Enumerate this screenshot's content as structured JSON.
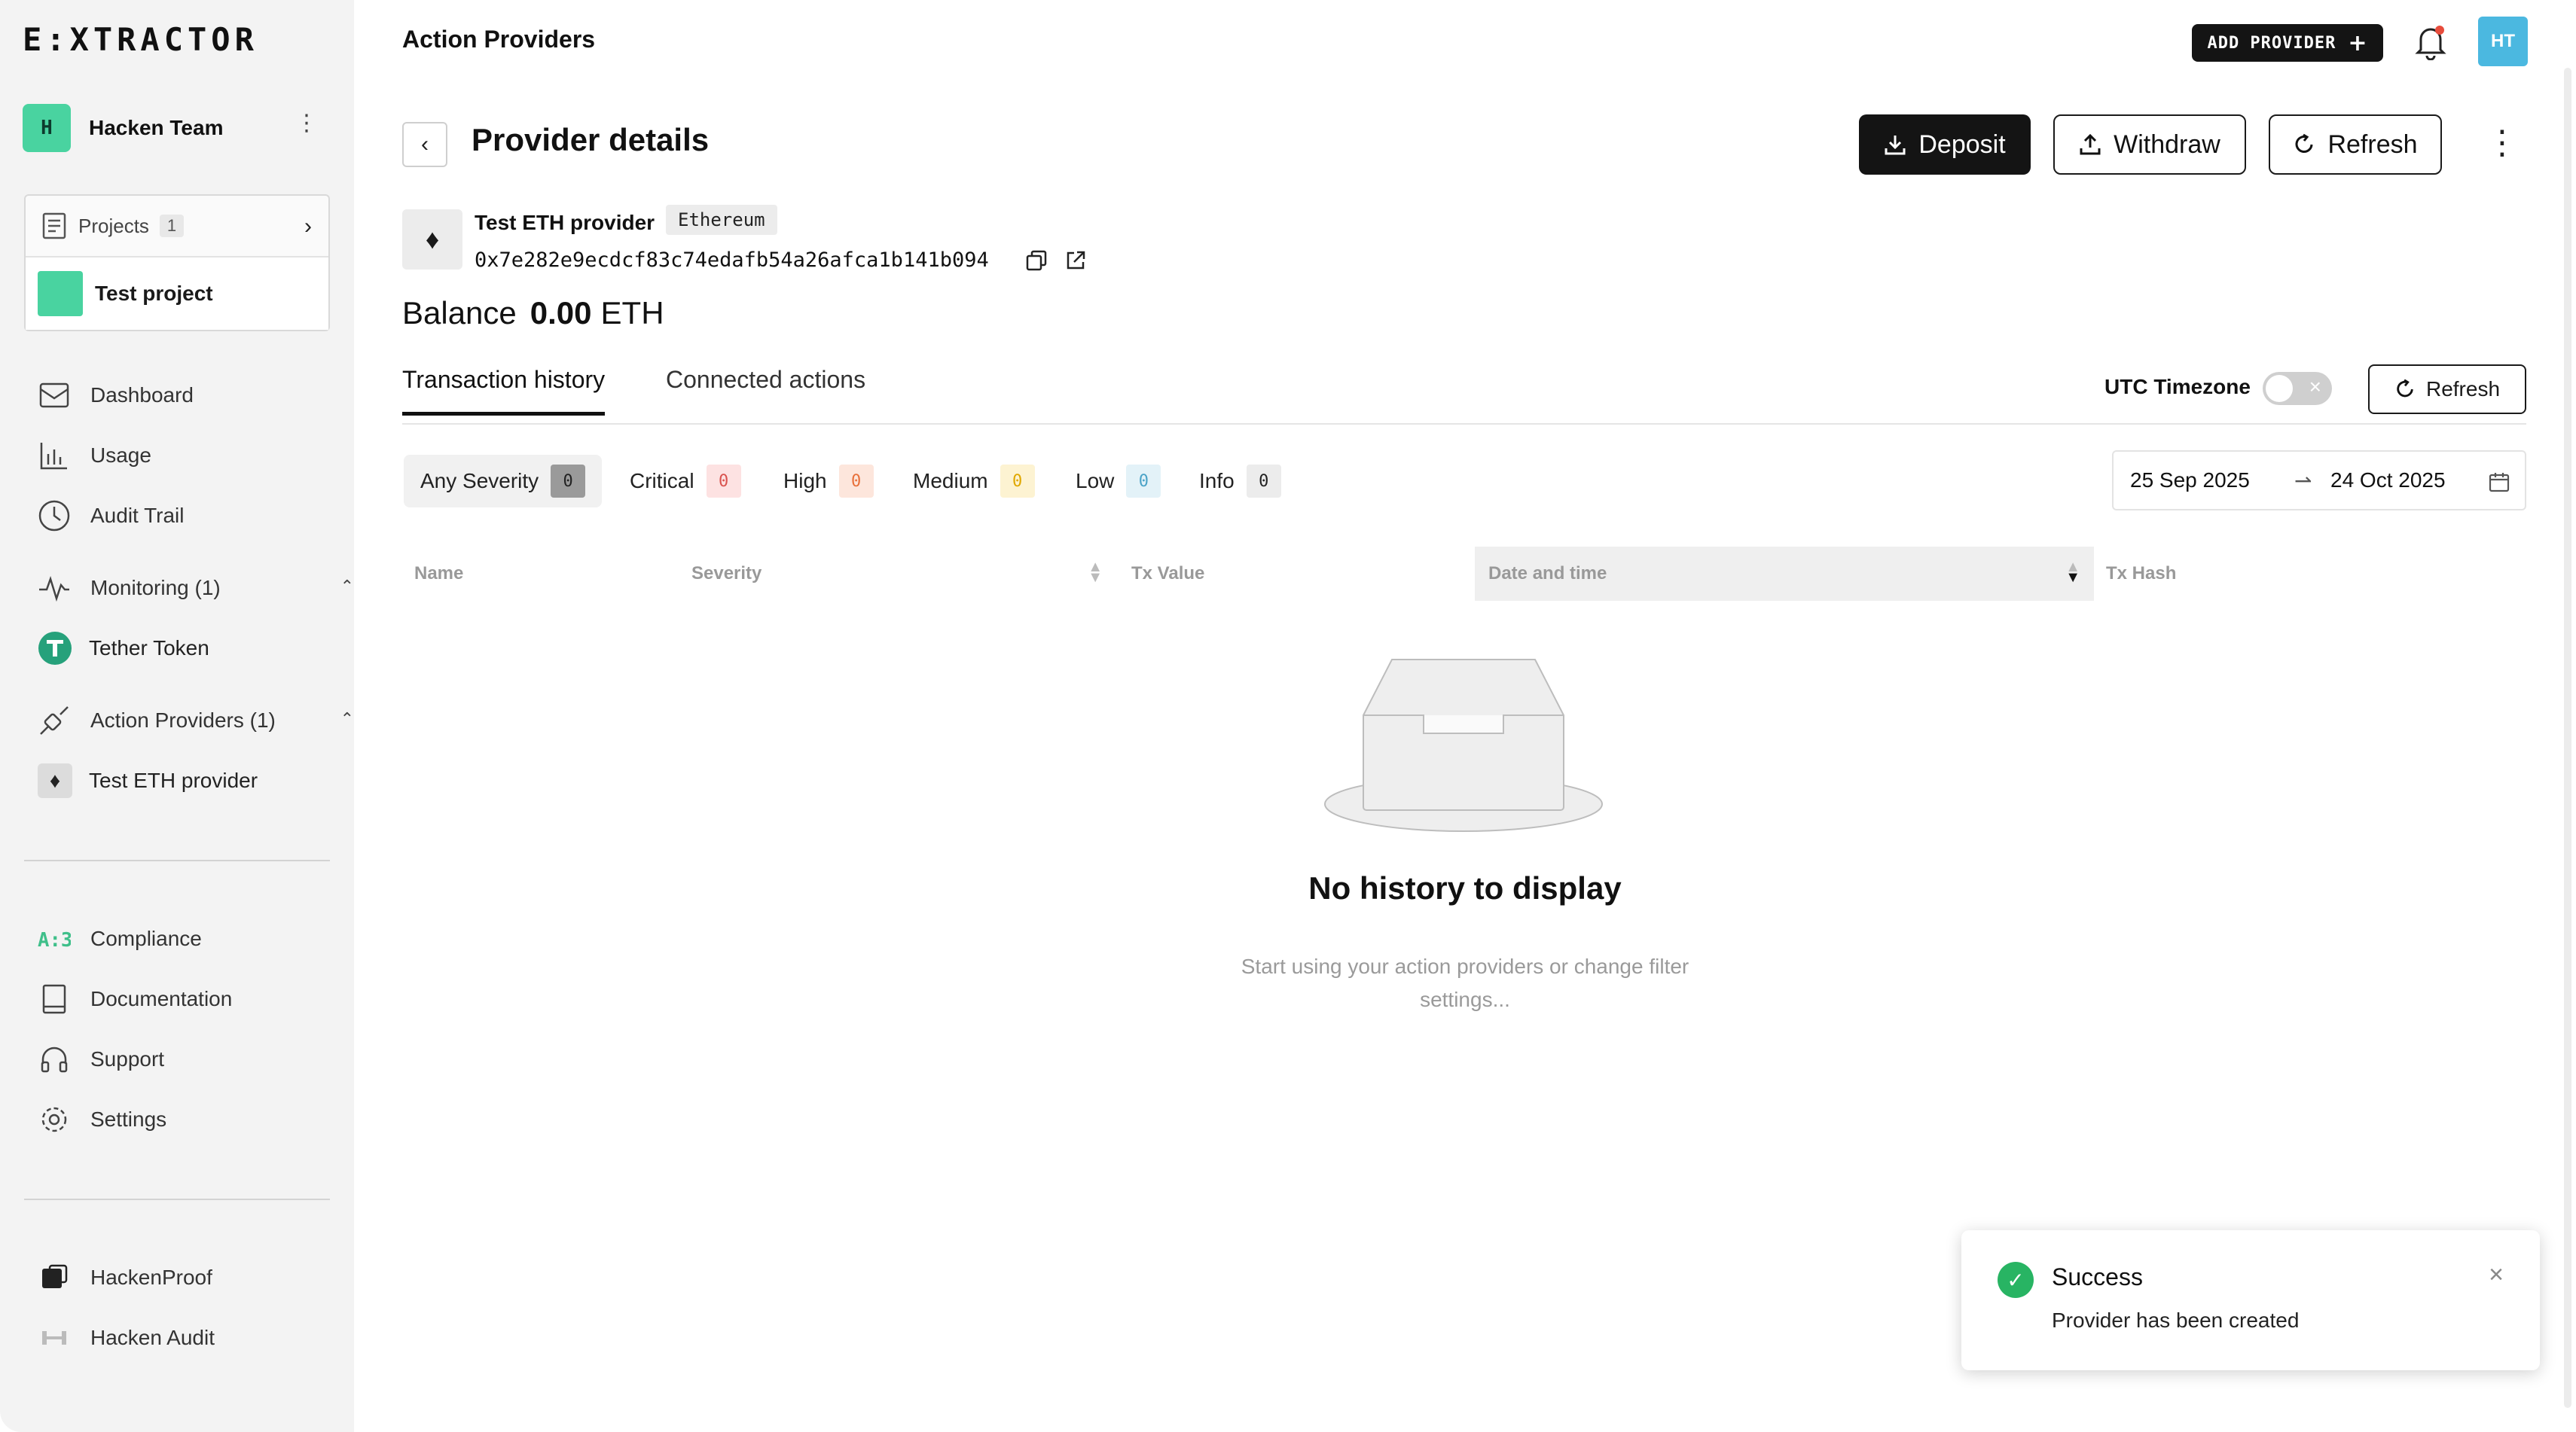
{
  "brand": {
    "logo_text": "E:XTRACTOR"
  },
  "sidebar": {
    "team_name": "Hacken Team",
    "projects_label": "Projects",
    "projects_count": "1",
    "project_name": "Test project",
    "nav": [
      {
        "label": "Dashboard"
      },
      {
        "label": "Usage"
      },
      {
        "label": "Audit Trail"
      },
      {
        "label": "Monitoring (1)"
      },
      {
        "label": "Tether Token"
      },
      {
        "label": "Action Providers (1)"
      },
      {
        "label": "Test ETH provider"
      },
      {
        "label": "Compliance"
      },
      {
        "label": "Documentation"
      },
      {
        "label": "Support"
      },
      {
        "label": "Settings"
      },
      {
        "label": "HackenProof"
      },
      {
        "label": "Hacken Audit"
      }
    ]
  },
  "header": {
    "title": "Action Providers",
    "add_provider": "ADD PROVIDER",
    "user_initials": "HT"
  },
  "page": {
    "title": "Provider details",
    "deposit": "Deposit",
    "withdraw": "Withdraw",
    "refresh": "Refresh",
    "provider_name": "Test ETH provider",
    "network": "Ethereum",
    "address": "0x7e282e9ecdcf83c74edafb54a26afca1b141b094",
    "balance_label": "Balance",
    "balance_value": "0.00",
    "balance_unit": "ETH"
  },
  "tabs": [
    {
      "label": "Transaction history",
      "active": true
    },
    {
      "label": "Connected actions",
      "active": false
    }
  ],
  "controls": {
    "utc_label": "UTC Timezone",
    "utc_enabled": false,
    "refresh": "Refresh"
  },
  "filters": [
    {
      "label": "Any Severity",
      "count": "0",
      "bg": "#9a9a9a",
      "fg": "#222"
    },
    {
      "label": "Critical",
      "count": "0",
      "bg": "#fde2e2",
      "fg": "#d9534f"
    },
    {
      "label": "High",
      "count": "0",
      "bg": "#fde6dc",
      "fg": "#e8703a"
    },
    {
      "label": "Medium",
      "count": "0",
      "bg": "#fdf3d2",
      "fg": "#e0a800"
    },
    {
      "label": "Low",
      "count": "0",
      "bg": "#e3f2f8",
      "fg": "#4ba3c7"
    },
    {
      "label": "Info",
      "count": "0",
      "bg": "#ececec",
      "fg": "#222"
    }
  ],
  "date_range": {
    "from": "25 Sep 2025",
    "to": "24 Oct 2025"
  },
  "table": {
    "columns": [
      "Name",
      "Severity",
      "Tx Value",
      "Date and time",
      "Tx Hash"
    ]
  },
  "empty": {
    "title": "No history to display",
    "subtitle": "Start using your action providers or change filter settings..."
  },
  "toast": {
    "title": "Success",
    "message": "Provider has been created"
  }
}
